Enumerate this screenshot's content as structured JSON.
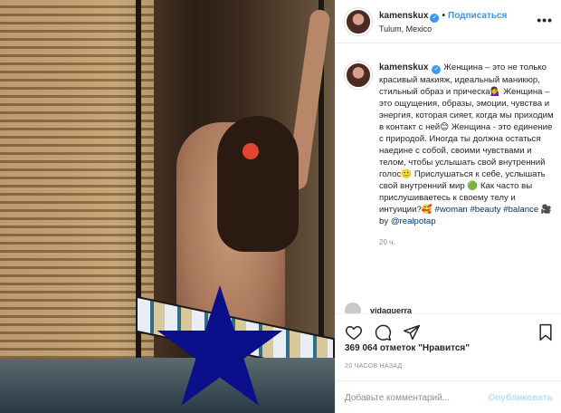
{
  "post": {
    "username": "kamenskux",
    "follow_label": "Подписаться",
    "location": "Tulum, Mexico",
    "caption_parts": {
      "p1": "Женщина – это не только красивый макияж, идеальный маникюр, стильный образ и прическа",
      "e1": "💁‍♀️",
      "p2": " Женщина – это ощущения, образы, эмоции, чувства и энергия, которая сияет, когда мы приходим в контакт с ней",
      "e2": "😊",
      "p3": " Женщина - это единение с природой. Иногда ты должна остаться наедине с собой, своими чувствами и телом, чтобы услышать свой внутренний голос",
      "e3": "🙂",
      "p4": " Прислушаться к себе, услышать свой внутренний мир ",
      "e4": "🟢",
      "p5": " Как часто вы прислушиваетесь к своему телу и интуиции?",
      "e5": "🥰",
      "tag1": "#woman",
      "tag2": "#beauty",
      "tag3": "#balance",
      "e6": "🎥",
      "by": " by ",
      "mention": "@realpotap"
    },
    "caption_time": "20 ч.",
    "next_commenter": "vidaquerra",
    "likes_text": "369 064 отметок \"Нравится\"",
    "time_ago": "20 ЧАСОВ НАЗАД",
    "comment_placeholder": "Добавьте комментарий...",
    "publish_label": "Опубликовать"
  },
  "icons": {
    "like": "heart-icon",
    "comment": "comment-icon",
    "share": "share-icon",
    "save": "bookmark-icon",
    "more": "more-icon",
    "verified": "verified-badge-icon"
  },
  "colors": {
    "accent": "#3897f0",
    "link": "#003569",
    "muted": "#8e8e8e",
    "publish_disabled": "#b2dffc",
    "censor_star": "#0b0f8a"
  }
}
